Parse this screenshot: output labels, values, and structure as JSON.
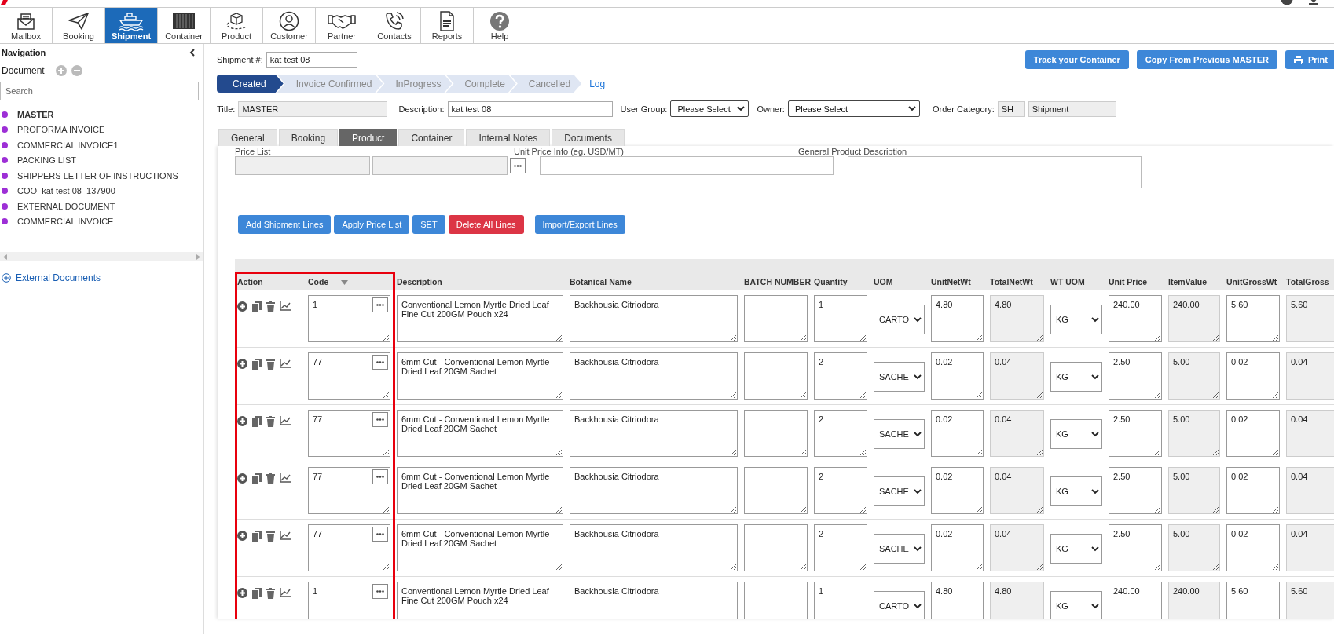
{
  "toolbar": [
    {
      "label": "Mailbox",
      "selected": false
    },
    {
      "label": "Booking",
      "selected": false
    },
    {
      "label": "Shipment",
      "selected": true
    },
    {
      "label": "Container",
      "selected": false
    },
    {
      "label": "Product",
      "selected": false
    },
    {
      "label": "Customer",
      "selected": false
    },
    {
      "label": "Partner",
      "selected": false
    },
    {
      "label": "Contacts",
      "selected": false
    },
    {
      "label": "Reports",
      "selected": false
    },
    {
      "label": "Help",
      "selected": false
    }
  ],
  "navigation": {
    "title": "Navigation",
    "section": "Document",
    "search": {
      "placeholder": "Search"
    },
    "documents": [
      {
        "label": "MASTER",
        "selected": true
      },
      {
        "label": "PROFORMA INVOICE",
        "selected": false
      },
      {
        "label": "COMMERCIAL INVOICE1",
        "selected": false
      },
      {
        "label": "PACKING LIST",
        "selected": false
      },
      {
        "label": "SHIPPERS LETTER OF INSTRUCTIONS",
        "selected": false
      },
      {
        "label": "COO_kat test 08_137900",
        "selected": false
      },
      {
        "label": "EXTERNAL DOCUMENT",
        "selected": false
      },
      {
        "label": "COMMERCIAL INVOICE",
        "selected": false
      }
    ],
    "external": "External Documents"
  },
  "shipment": {
    "label": "Shipment #:",
    "value": "kat test 08"
  },
  "actions": [
    {
      "label": "Track your Container",
      "kind": "plain"
    },
    {
      "label": "Copy From Previous MASTER",
      "kind": "plain"
    },
    {
      "label": "Print",
      "kind": "print"
    }
  ],
  "steps": [
    {
      "label": "Created",
      "selected": true
    },
    {
      "label": "Invoice Confirmed",
      "selected": false
    },
    {
      "label": "InProgress",
      "selected": false
    },
    {
      "label": "Complete",
      "selected": false
    },
    {
      "label": "Cancelled",
      "selected": false
    }
  ],
  "log": "Log",
  "fields": [
    {
      "label": "Title:",
      "value": "MASTER",
      "kind": "readonly"
    },
    {
      "label": "Description:",
      "value": "kat test 08",
      "kind": "text"
    },
    {
      "label": "User Group:",
      "value": "Please Select",
      "kind": "select"
    },
    {
      "label": "Owner:",
      "value": "Please Select",
      "kind": "select"
    },
    {
      "label": "Order Category:",
      "value": "SH",
      "kind": "readonly"
    },
    {
      "value": "Shipment",
      "kind": "readonly"
    }
  ],
  "tabs": [
    {
      "label": "General",
      "selected": false
    },
    {
      "label": "Booking",
      "selected": false
    },
    {
      "label": "Product",
      "selected": true
    },
    {
      "label": "Container",
      "selected": false
    },
    {
      "label": "Internal Notes",
      "selected": false
    },
    {
      "label": "Documents",
      "selected": false
    }
  ],
  "price_section": {
    "price_list_label": "Price List",
    "unit_price_label": "Unit Price Info (eg. USD/MT)",
    "description_label": "General Product Description"
  },
  "line_buttons": [
    {
      "label": "Add Shipment Lines",
      "kind": "primary"
    },
    {
      "label": "Apply Price List",
      "kind": "primary"
    },
    {
      "label": "SET",
      "kind": "primary"
    },
    {
      "label": "Delete All Lines",
      "kind": "danger"
    },
    {
      "label": "Import/Export Lines",
      "kind": "primary"
    }
  ],
  "table": {
    "columns": [
      {
        "label": "Action",
        "kind": "actions",
        "sorted": false
      },
      {
        "label": "Code",
        "kind": "lookup",
        "sorted": true
      },
      {
        "label": "Description",
        "kind": "text",
        "sorted": false
      },
      {
        "label": "Botanical Name",
        "kind": "text",
        "sorted": false
      },
      {
        "label": "BATCH NUMBER",
        "kind": "text",
        "sorted": false
      },
      {
        "label": "Quantity",
        "kind": "text",
        "sorted": false
      },
      {
        "label": "UOM",
        "kind": "select",
        "sorted": false
      },
      {
        "label": "UnitNetWt",
        "kind": "text",
        "sorted": false
      },
      {
        "label": "TotalNetWt",
        "kind": "readonly",
        "sorted": false
      },
      {
        "label": "WT UOM",
        "kind": "select",
        "sorted": false
      },
      {
        "label": "Unit Price",
        "kind": "text",
        "sorted": false
      },
      {
        "label": "ItemValue",
        "kind": "readonly",
        "sorted": false
      },
      {
        "label": "UnitGrossWt",
        "kind": "text",
        "sorted": false
      },
      {
        "label": "TotalGross",
        "kind": "readonly",
        "sorted": false
      }
    ],
    "rows": [
      {
        "cells": [
          "",
          "1",
          "Conventional Lemon Myrtle Dried Leaf Fine Cut 200GM Pouch x24",
          "Backhousia Citriodora",
          "",
          "1",
          "CARTO",
          "4.80",
          "4.80",
          "KG",
          "240.00",
          "240.00",
          "5.60",
          "5.60"
        ]
      },
      {
        "cells": [
          "",
          "77",
          "6mm Cut - Conventional Lemon Myrtle Dried Leaf 20GM Sachet",
          "Backhousia Citriodora",
          "",
          "2",
          "SACHE",
          "0.02",
          "0.04",
          "KG",
          "2.50",
          "5.00",
          "0.02",
          "0.04"
        ]
      },
      {
        "cells": [
          "",
          "77",
          "6mm Cut - Conventional Lemon Myrtle Dried Leaf 20GM Sachet",
          "Backhousia Citriodora",
          "",
          "2",
          "SACHE",
          "0.02",
          "0.04",
          "KG",
          "2.50",
          "5.00",
          "0.02",
          "0.04"
        ]
      },
      {
        "cells": [
          "",
          "77",
          "6mm Cut - Conventional Lemon Myrtle Dried Leaf 20GM Sachet",
          "Backhousia Citriodora",
          "",
          "2",
          "SACHE",
          "0.02",
          "0.04",
          "KG",
          "2.50",
          "5.00",
          "0.02",
          "0.04"
        ]
      },
      {
        "cells": [
          "",
          "77",
          "6mm Cut - Conventional Lemon Myrtle Dried Leaf 20GM Sachet",
          "Backhousia Citriodora",
          "",
          "2",
          "SACHE",
          "0.02",
          "0.04",
          "KG",
          "2.50",
          "5.00",
          "0.02",
          "0.04"
        ]
      },
      {
        "cells": [
          "",
          "1",
          "Conventional Lemon Myrtle Dried Leaf Fine Cut 200GM Pouch x24",
          "Backhousia Citriodora",
          "",
          "1",
          "CARTO",
          "4.80",
          "4.80",
          "KG",
          "240.00",
          "240.00",
          "5.60",
          "5.60"
        ]
      }
    ]
  }
}
